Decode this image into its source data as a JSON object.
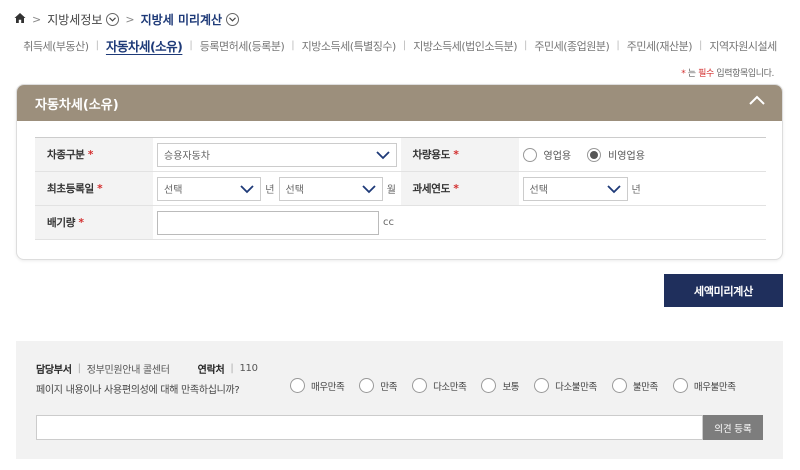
{
  "breadcrumb": {
    "home_icon": "home-icon",
    "level1": "지방세정보",
    "level2": "지방세 미리계산"
  },
  "tabs": [
    {
      "label": "취득세(부동산)",
      "active": false
    },
    {
      "label": "자동차세(소유)",
      "active": true
    },
    {
      "label": "등록면허세(등록분)",
      "active": false
    },
    {
      "label": "지방소득세(특별징수)",
      "active": false
    },
    {
      "label": "지방소득세(법인소득분)",
      "active": false
    },
    {
      "label": "주민세(종업원분)",
      "active": false
    },
    {
      "label": "주민세(재산분)",
      "active": false
    },
    {
      "label": "지역자원시설세",
      "active": false
    }
  ],
  "required_note": {
    "star": "*",
    "pre": "는 ",
    "emph": "필수",
    "post": " 입력항목입니다."
  },
  "panel": {
    "title": "자동차세(소유)",
    "collapse_icon": "chevron-up-icon",
    "vehicle_type": {
      "label": "차종구분",
      "value": "승용자동차"
    },
    "vehicle_use": {
      "label": "차량용도",
      "options": [
        "영업용",
        "비영업용"
      ],
      "selected": "비영업용"
    },
    "first_reg": {
      "label": "최초등록일",
      "year_placeholder": "선택",
      "year_unit": "년",
      "month_placeholder": "선택",
      "month_unit": "월"
    },
    "tax_year": {
      "label": "과세연도",
      "placeholder": "선택",
      "unit": "년"
    },
    "displacement": {
      "label": "배기량",
      "value": "",
      "unit": "cc"
    },
    "required_star": "*"
  },
  "calc_button": "세액미리계산",
  "feedback": {
    "dept_label": "담당부서",
    "dept_value": "정부민원안내 콜센터",
    "contact_label": "연락처",
    "contact_value": "110",
    "question": "페이지 내용이나 사용편의성에 대해 만족하십니까?",
    "options": [
      "매우만족",
      "만족",
      "다소만족",
      "보통",
      "다소불만족",
      "불만족",
      "매우불만족"
    ],
    "opinion_value": "",
    "submit_label": "의견 등록"
  },
  "colors": {
    "accent": "#1e3a78",
    "panel_header": "#9c8f7c",
    "button": "#1f2f5c",
    "required": "#d32f2f"
  }
}
